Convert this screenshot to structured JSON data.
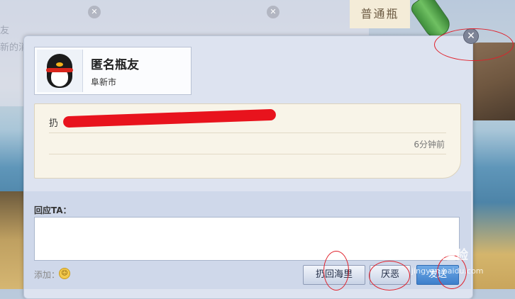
{
  "background": {
    "panel_text_1": "友",
    "panel_text_2": "新的消"
  },
  "bottle_tag": {
    "label": "普通瓶",
    "icon": "green-bottle-icon"
  },
  "dialog": {
    "close_icon": "close-icon",
    "profile": {
      "avatar_icon": "qq-penguin-avatar-icon",
      "name": "匿名瓶友",
      "city": "阜新市"
    },
    "message": {
      "text_visible": "扔",
      "time": "6分钟前"
    },
    "reply": {
      "label": "回应TA：",
      "input_value": "",
      "add_label": "添加：",
      "emoji_icon": "smiley-icon"
    },
    "buttons": {
      "throw_back": "扔回海里",
      "hate": "厌恶",
      "send": "发送"
    }
  },
  "watermark": {
    "brand": "Baidu 经验",
    "url": "jingyan.baidu.com"
  },
  "colors": {
    "accent": "#3d7fcb",
    "redaction": "#e8131d",
    "dialog_bg": "#dde3f0",
    "message_bg": "#f8f4e8"
  }
}
